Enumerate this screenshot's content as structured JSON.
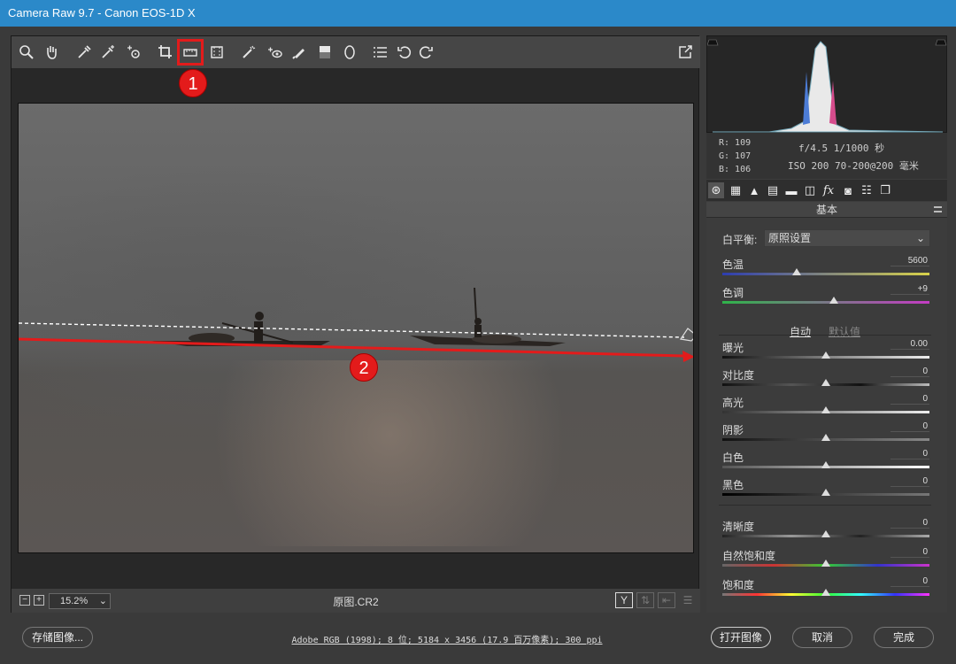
{
  "window": {
    "title": "Camera Raw 9.7 -  Canon EOS-1D X"
  },
  "annotations": {
    "marker1": "1",
    "marker2": "2"
  },
  "bottom": {
    "zoom": "15.2%",
    "filename": "原图.CR2",
    "view_y": "Y"
  },
  "info": {
    "r": "R:  109",
    "g": "G:  107",
    "b": "B:  106",
    "exposure": "f/4.5  1/1000 秒",
    "iso_lens": "ISO 200  70-200@200 毫米"
  },
  "panel": {
    "title": "基本",
    "wb_label": "白平衡:",
    "wb_value": "原照设置",
    "auto": "自动",
    "default": "默认值",
    "sliders": [
      {
        "label": "色温",
        "value": "5600",
        "pos": 0.36
      },
      {
        "label": "色调",
        "value": "+9",
        "pos": 0.54
      },
      {
        "label": "曝光",
        "value": "0.00",
        "pos": 0.5
      },
      {
        "label": "对比度",
        "value": "0",
        "pos": 0.5
      },
      {
        "label": "高光",
        "value": "0",
        "pos": 0.5
      },
      {
        "label": "阴影",
        "value": "0",
        "pos": 0.5
      },
      {
        "label": "白色",
        "value": "0",
        "pos": 0.5
      },
      {
        "label": "黑色",
        "value": "0",
        "pos": 0.5
      },
      {
        "label": "清晰度",
        "value": "0",
        "pos": 0.5
      },
      {
        "label": "自然饱和度",
        "value": "0",
        "pos": 0.5
      },
      {
        "label": "饱和度",
        "value": "0",
        "pos": 0.5
      }
    ]
  },
  "footer": {
    "save": "存储图像...",
    "workflow": "Adobe RGB (1998); 8 位; 5184 x 3456 (17.9 百万像素); 300 ppi",
    "open": "打开图像",
    "cancel": "取消",
    "done": "完成"
  },
  "colors": {
    "titlebar": "#2b89c9",
    "annotation": "#e31b1b"
  }
}
